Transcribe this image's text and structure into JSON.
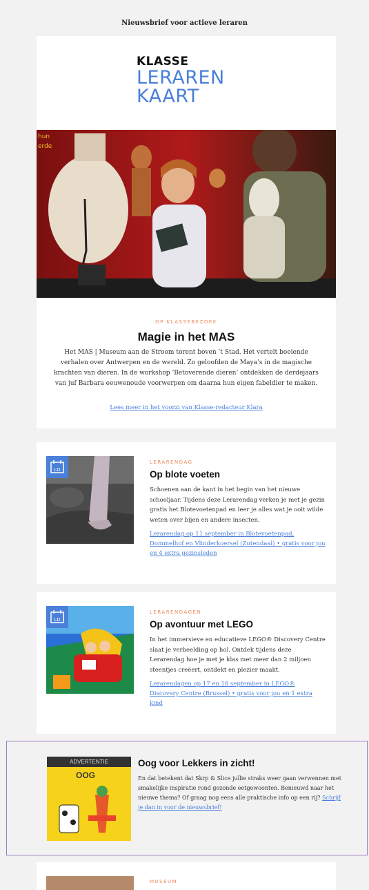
{
  "newsletter_title": "Nieuwsbrief voor actieve leraren",
  "logo": {
    "line1": "KLASSE",
    "line2": "LERAREN",
    "line3": "KAART"
  },
  "featured": {
    "kicker": "OP KLASSEBEZOEK",
    "title": "Magie in het MAS",
    "body": "Het MAS | Museum aan de Stroom torent boven ’t Stad. Het vertelt boeiende verhalen over Antwerpen en de wereld. Zo geloofden de Maya’s in de magische krachten van dieren. In de workshop ‘Betoverende dieren’ ontdekken de derdejaars van juf Barbara eeuwenoude voorwerpen om daarna hun eigen fabeldier te maken.",
    "link": "Lees meer in het voorzi van Klasse-redacteur Klara"
  },
  "items": [
    {
      "kicker": "LERARENDAG",
      "title": "Op blote voeten",
      "body": "Schoenen aan de kant in het begin van het nieuwe schooljaar. Tijdens deze Lerarendag verken je met je gezin gratis het Blotevoetenpad en leer je alles wat je ooit wilde weten over bijen en andere insecten.",
      "link": "Lerarendag op 11 september in Blotevoetenpad, Dommelhof en Vlinderkoersel (Zutendaal) • gratis voor jou en 4 extra gezinsleden",
      "badge": "LD"
    },
    {
      "kicker": "LERARENDAGEN",
      "title": "Op avontuur met LEGO",
      "body": "In het immersieve en educatieve LEGO® Discovery Centre slaat je verbeelding op hol. Ontdek tijdens deze Lerarendag hoe je met je klas met meer dan 2 miljoen steentjes creëert, ontdekt en plezier maakt.",
      "link": "Lerarendagen op 17 en 18 september in LEGO® Discovery Centre (Brussel) • gratis voor jou en 1 extra kind",
      "badge": "LD"
    }
  ],
  "ad": {
    "label": "ADVERTENTIE",
    "logo_text": "OOG",
    "title": "Oog voor Lekkers in zicht!",
    "body": "En dat betekent dat Skrp & Slice jullie straks weer gaan verwennen met smakelijke inspiratie rond gezonde eetgewoonten. Benieuwd naar het nieuwe thema? Of graag nog eens alle praktische info op een rij?",
    "link": "Schrijf je dan in voor de nieuwsbrief!"
  },
  "next_item": {
    "kicker": "MUSEUM"
  },
  "colors": {
    "accent_blue": "#4a80d9",
    "kicker_orange": "#f08a5d",
    "ad_border": "#9a7bc0"
  }
}
